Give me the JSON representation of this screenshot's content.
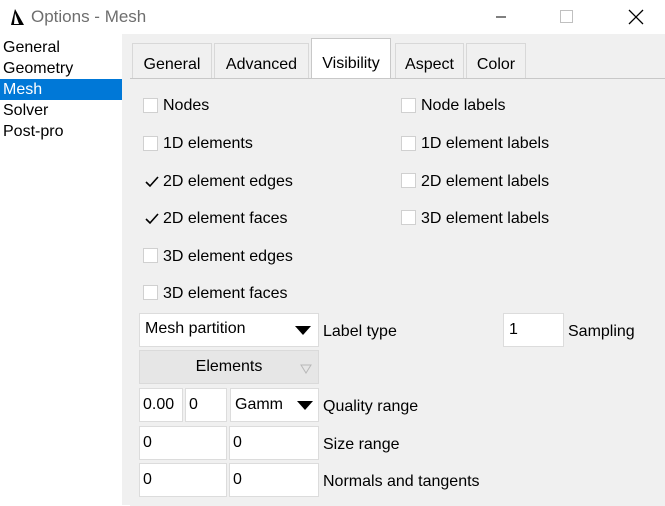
{
  "window": {
    "title": "Options - Mesh",
    "controls": [
      "minimize-icon",
      "maximize-icon",
      "close-icon"
    ]
  },
  "sidebar": {
    "items": [
      "General",
      "Geometry",
      "Mesh",
      "Solver",
      "Post-pro"
    ],
    "selected": "Mesh"
  },
  "tabs": {
    "items": [
      "General",
      "Advanced",
      "Visibility",
      "Aspect",
      "Color"
    ],
    "active": "Visibility"
  },
  "visibility": {
    "nodes": {
      "label": "Nodes",
      "checked": false
    },
    "node_labels": {
      "label": "Node labels",
      "checked": false
    },
    "elements_1d": {
      "label": "1D elements",
      "checked": false
    },
    "element_labels_1d": {
      "label": "1D element labels",
      "checked": false
    },
    "element_edges_2d": {
      "label": "2D element edges",
      "checked": true
    },
    "element_labels_2d": {
      "label": "2D element labels",
      "checked": false
    },
    "element_faces_2d": {
      "label": "2D element faces",
      "checked": true
    },
    "element_labels_3d": {
      "label": "3D element labels",
      "checked": false
    },
    "element_edges_3d": {
      "label": "3D element edges",
      "checked": false
    },
    "element_faces_3d": {
      "label": "3D element faces",
      "checked": false
    },
    "label_type": {
      "value": "Mesh partition",
      "label": "Label type"
    },
    "sampling": {
      "value": "1",
      "label": "Sampling"
    },
    "elements_button": "Elements",
    "quality_range": {
      "min": "0.00",
      "max": "0",
      "type": "Gamm",
      "label": "Quality range"
    },
    "size_range": {
      "min": "0",
      "max": "0",
      "label": "Size range"
    },
    "normals": {
      "normals": "0",
      "tangents": "0",
      "label": "Normals and tangents"
    }
  },
  "colors": {
    "accent": "#0078d7",
    "panel_bg": "#f0f0f0",
    "title_text": "#6e6e6e"
  }
}
